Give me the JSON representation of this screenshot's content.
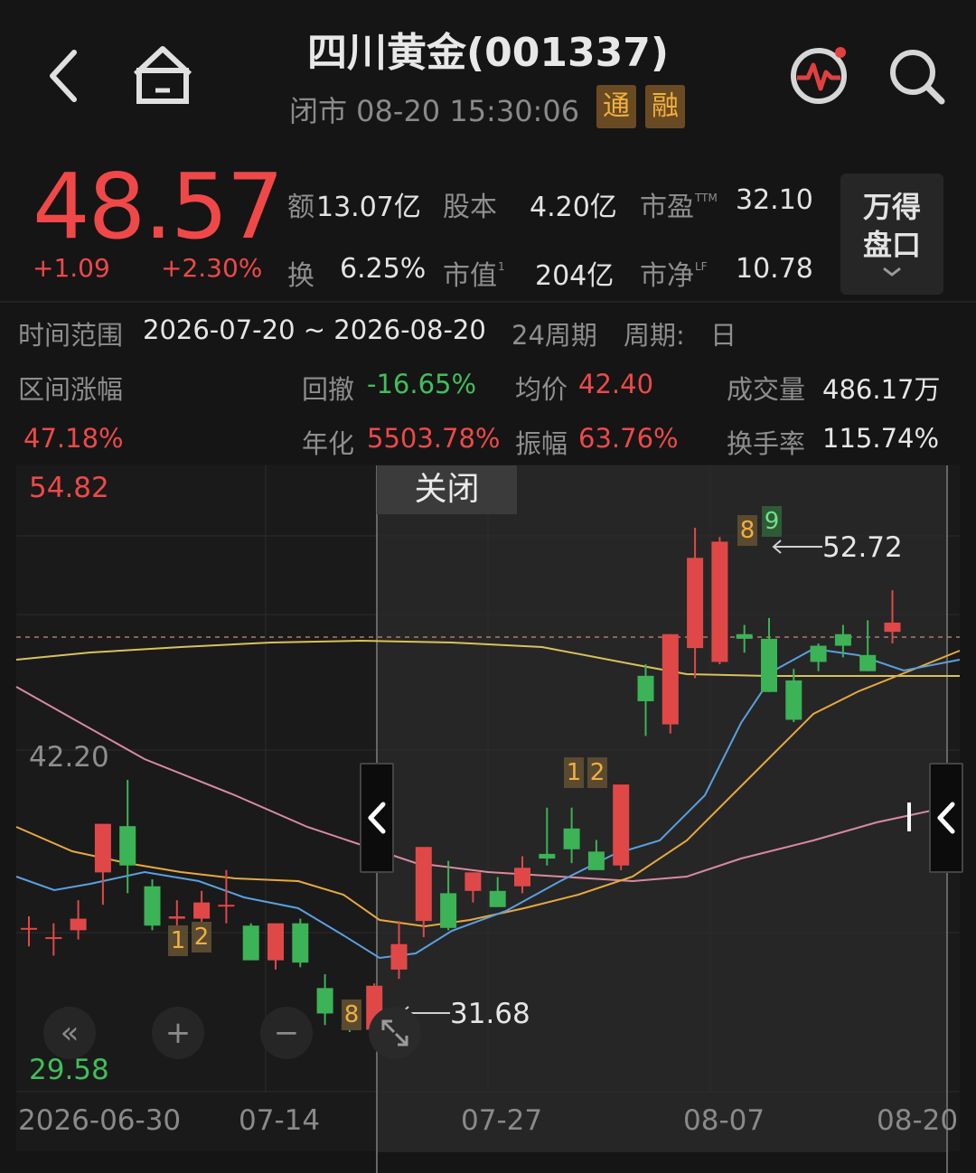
{
  "header": {
    "title": "四川黄金(001337)",
    "status": "闭市 08-20 15:30:06",
    "tags": [
      "通",
      "融"
    ]
  },
  "quote": {
    "price": "48.57",
    "change": "+1.09",
    "change_pct": "+2.30%",
    "metrics": {
      "amount_label": "额",
      "amount": "13.07亿",
      "shares_label": "股本",
      "shares": "4.20亿",
      "pe_label": "市盈",
      "pe_sup": "TTM",
      "pe": "32.10",
      "turnover_label": "换",
      "turnover": "6.25%",
      "mcap_label": "市值",
      "mcap_sup": "1",
      "mcap": "204亿",
      "pb_label": "市净",
      "pb_sup": "LF",
      "pb": "10.78"
    },
    "panel_button": [
      "万得",
      "盘口"
    ]
  },
  "range": {
    "time_label": "时间范围",
    "time_value": "2026-07-20 ~ 2026-08-20",
    "periods": "24周期",
    "cycle_label": "周期:",
    "cycle_value": "日",
    "gain_label": "区间涨幅",
    "gain_value": "47.18%",
    "drawdown_label": "回撤",
    "drawdown_value": "-16.65%",
    "avg_label": "均价",
    "avg_value": "42.40",
    "volume_label": "成交量",
    "volume_value": "486.17万",
    "annual_label": "年化",
    "annual_value": "5503.78%",
    "amplitude_label": "振幅",
    "amplitude_value": "63.76%",
    "turnrate_label": "换手率",
    "turnrate_value": "115.74%"
  },
  "chart": {
    "close_label": "关闭",
    "y_high": "54.82",
    "y_mid": "42.20",
    "y_low": "29.58",
    "high_marker": "52.72",
    "low_marker": "31.68",
    "x_labels": [
      "2026-06-30",
      "07-14",
      "07-27",
      "08-07",
      "08-20"
    ],
    "badges": [
      "1",
      "2",
      "8",
      "1",
      "2",
      "8",
      "9"
    ],
    "controls": [
      "«",
      "+",
      "−"
    ]
  },
  "chart_data": {
    "type": "candlestick",
    "ylim": [
      29.58,
      54.82
    ],
    "y_ticks": [
      54.82,
      42.2,
      29.58
    ],
    "x_ticks": [
      "2026-06-30",
      "07-14",
      "07-27",
      "08-07",
      "08-20"
    ],
    "candles": [
      {
        "o": 35.8,
        "h": 36.3,
        "l": 35.0,
        "c": 35.8
      },
      {
        "o": 35.4,
        "h": 36.0,
        "l": 34.6,
        "c": 35.4
      },
      {
        "o": 35.7,
        "h": 37.0,
        "l": 35.3,
        "c": 36.2
      },
      {
        "o": 38.2,
        "h": 38.3,
        "l": 36.8,
        "c": 40.3
      },
      {
        "o": 40.2,
        "h": 42.2,
        "l": 37.3,
        "c": 38.5
      },
      {
        "o": 37.6,
        "h": 37.9,
        "l": 35.7,
        "c": 35.9
      },
      {
        "o": 36.2,
        "h": 37.0,
        "l": 34.9,
        "c": 36.3
      },
      {
        "o": 36.2,
        "h": 37.4,
        "l": 35.7,
        "c": 36.9
      },
      {
        "o": 36.8,
        "h": 38.3,
        "l": 36.0,
        "c": 36.8
      },
      {
        "o": 35.9,
        "h": 36.0,
        "l": 34.9,
        "c": 34.4
      },
      {
        "o": 34.4,
        "h": 35.9,
        "l": 34.0,
        "c": 36.0
      },
      {
        "o": 36.0,
        "h": 36.2,
        "l": 34.1,
        "c": 34.3
      },
      {
        "o": 33.2,
        "h": 33.8,
        "l": 31.6,
        "c": 32.1
      },
      {
        "o": 31.7,
        "h": 32.5,
        "l": 31.3,
        "c": 31.4
      },
      {
        "o": 31.4,
        "h": 33.4,
        "l": 31.0,
        "c": 33.3
      },
      {
        "o": 34.0,
        "h": 36.1,
        "l": 33.6,
        "c": 35.1
      },
      {
        "o": 36.1,
        "h": 38.3,
        "l": 35.4,
        "c": 39.3
      },
      {
        "o": 37.3,
        "h": 38.7,
        "l": 35.7,
        "c": 35.8
      },
      {
        "o": 37.4,
        "h": 38.2,
        "l": 36.9,
        "c": 38.2
      },
      {
        "o": 37.4,
        "h": 38.0,
        "l": 36.9,
        "c": 36.7
      },
      {
        "o": 37.6,
        "h": 38.9,
        "l": 37.3,
        "c": 38.4
      },
      {
        "o": 39.0,
        "h": 41.0,
        "l": 38.5,
        "c": 38.8
      },
      {
        "o": 40.1,
        "h": 41.0,
        "l": 38.6,
        "c": 39.2
      },
      {
        "o": 39.1,
        "h": 39.6,
        "l": 38.8,
        "c": 38.3
      },
      {
        "o": 38.5,
        "h": 39.7,
        "l": 38.3,
        "c": 42.0
      },
      {
        "o": 46.7,
        "h": 47.2,
        "l": 44.1,
        "c": 45.6
      },
      {
        "o": 44.6,
        "h": 48.5,
        "l": 44.2,
        "c": 48.5
      },
      {
        "o": 47.9,
        "h": 53.1,
        "l": 46.6,
        "c": 51.8
      },
      {
        "o": 47.3,
        "h": 52.7,
        "l": 47.2,
        "c": 52.5
      },
      {
        "o": 48.5,
        "h": 48.9,
        "l": 47.7,
        "c": 48.3
      },
      {
        "o": 48.3,
        "h": 49.2,
        "l": 46.0,
        "c": 46.0
      },
      {
        "o": 46.5,
        "h": 47.0,
        "l": 44.7,
        "c": 44.8
      },
      {
        "o": 48.0,
        "h": 48.1,
        "l": 46.9,
        "c": 47.3
      },
      {
        "o": 48.5,
        "h": 48.9,
        "l": 47.5,
        "c": 48.0
      },
      {
        "o": 47.6,
        "h": 49.1,
        "l": 46.9,
        "c": 46.9
      },
      {
        "o": 48.6,
        "h": 50.4,
        "l": 48.1,
        "c": 49.0
      }
    ]
  }
}
